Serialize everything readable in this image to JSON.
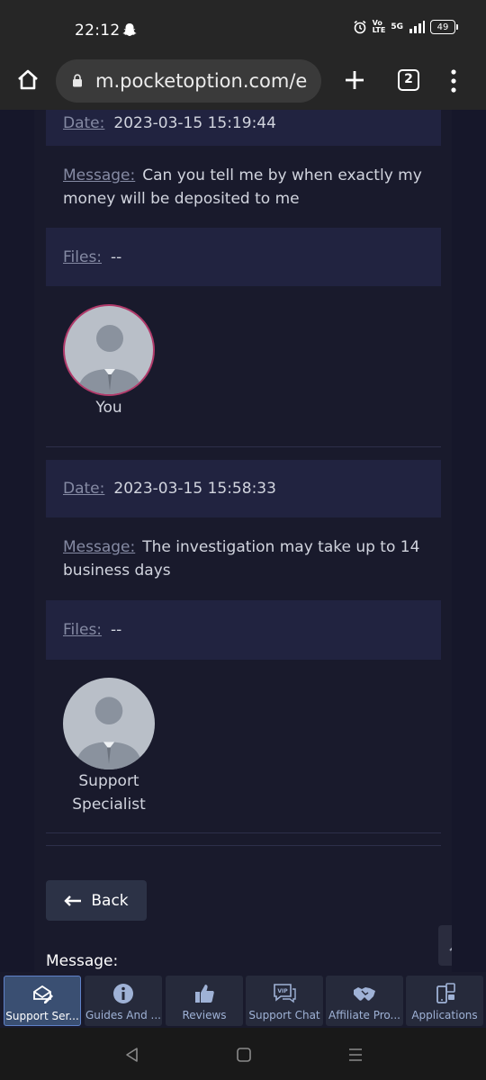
{
  "status_bar": {
    "time": "22:12",
    "volte": "Vo\nLTE",
    "network": "5G",
    "battery": "49"
  },
  "browser": {
    "url": "m.pocketoption.com/e",
    "tab_count": "2"
  },
  "messages": [
    {
      "date_label": "Date:",
      "date": "2023-03-15 15:19:44",
      "message_label": "Message:",
      "message": "Can you tell me by when exactly my money will be deposited to me",
      "files_label": "Files:",
      "files": "--",
      "author": "You"
    },
    {
      "date_label": "Date:",
      "date": "2023-03-15 15:58:33",
      "message_label": "Message:",
      "message": "The investigation may take up to 14 business days",
      "files_label": "Files:",
      "files": "--",
      "author": "Support Specialist"
    }
  ],
  "back_label": "Back",
  "compose_label": "Message:",
  "bottom_nav": [
    {
      "label": "Support Ser...",
      "icon": "support-icon",
      "active": true
    },
    {
      "label": "Guides And ...",
      "icon": "info-icon",
      "active": false
    },
    {
      "label": "Reviews",
      "icon": "thumbs-up-icon",
      "active": false
    },
    {
      "label": "Support Chat",
      "icon": "vip-chat-icon",
      "active": false
    },
    {
      "label": "Affiliate Pro...",
      "icon": "handshake-icon",
      "active": false
    },
    {
      "label": "Applications",
      "icon": "devices-icon",
      "active": false
    }
  ],
  "colors": {
    "background": "#191a2c",
    "card_dark": "#212340",
    "label": "#858aa3",
    "active_nav": "#3a4f72",
    "avatar_border_you": "#b03a6a"
  }
}
